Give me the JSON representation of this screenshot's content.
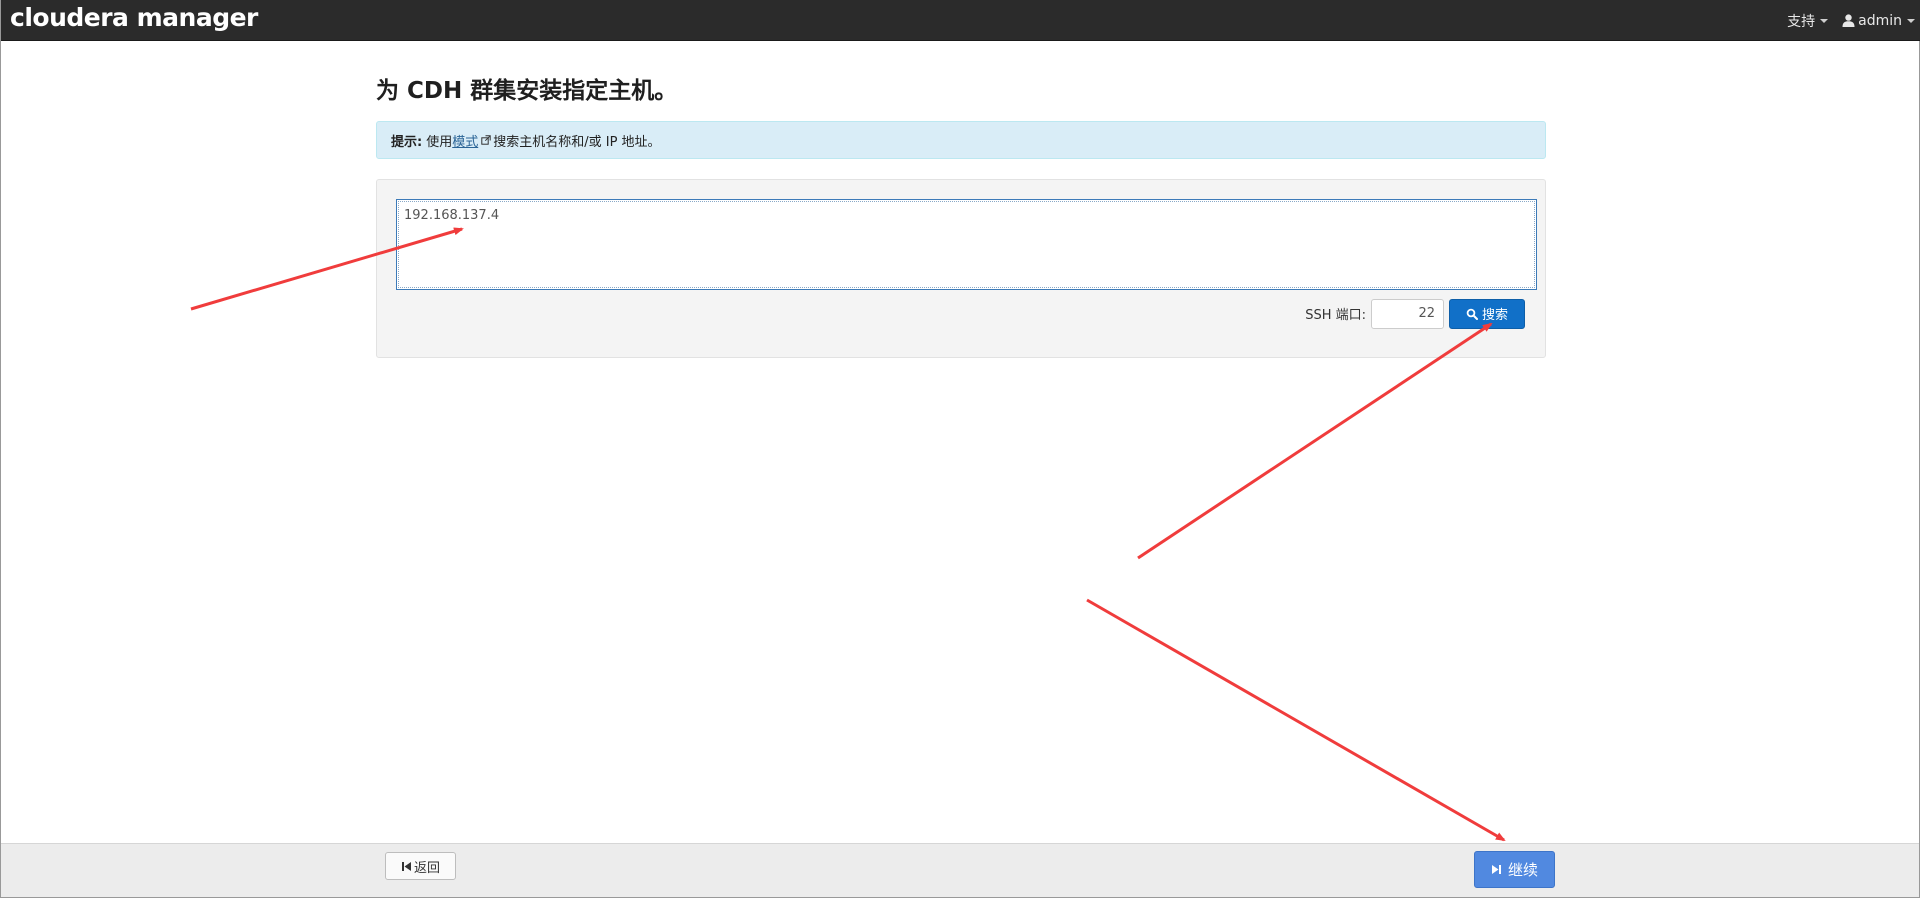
{
  "navbar": {
    "brand": "cloudera manager",
    "support_label": "支持",
    "user_label": "admin"
  },
  "main": {
    "title": "为 CDH 群集安装指定主机。",
    "hint": {
      "label": "提示:",
      "text_before": "使用",
      "link": "模式",
      "text_after": "搜索主机名称和/或 IP 地址。"
    },
    "search": {
      "hosts_value": "192.168.137.4",
      "ssh_port_label": "SSH 端口:",
      "ssh_port_value": "22",
      "search_button": "搜索"
    }
  },
  "footer": {
    "back_button": "返回",
    "continue_button": "继续"
  },
  "colors": {
    "navbar_bg": "#2b2b2b",
    "hint_bg": "#d9edf7",
    "primary_button": "#1170c8",
    "continue_button": "#5189e0",
    "annotation_arrow": "#f03c3c"
  }
}
